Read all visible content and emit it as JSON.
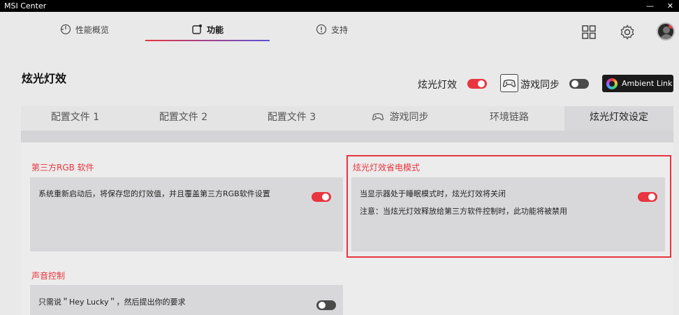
{
  "app": {
    "title": "MSI Center",
    "minimize": "—",
    "close": "✕"
  },
  "nav": {
    "tabs": [
      {
        "label": "性能概览",
        "icon": "gauge-icon"
      },
      {
        "label": "功能",
        "icon": "feature-icon"
      },
      {
        "label": "支持",
        "icon": "support-icon"
      }
    ],
    "active": 1
  },
  "header": {
    "title": "炫光灯效",
    "mystic_label": "炫光灯效",
    "mystic_on": true,
    "gamesync_label": "游戏同步",
    "gamesync_on": false,
    "ambient_label": "Ambient Link"
  },
  "subtabs": [
    "配置文件 1",
    "配置文件 2",
    "配置文件 3",
    "游戏同步",
    "环境链路",
    "炫光灯效设定"
  ],
  "sections": {
    "rgb": {
      "title": "第三方RGB 软件",
      "text": "系统重新启动后，将保存您的灯效值，并且覆盖第三方RGB软件设置",
      "on": true
    },
    "power": {
      "title": "炫光灯效省电模式",
      "text1": "当显示器处于睡眠模式时，炫光灯效将关闭",
      "text2": "注意：当炫光灯效释放给第三方软件控制时，此功能将被禁用",
      "on": true
    },
    "voice": {
      "title": "声音控制",
      "text": "只需说＂Hey Lucky＂，然后提出你的要求",
      "on": false
    }
  },
  "colors": {
    "accent": "#e8353f",
    "dark": "#1b1b1b"
  }
}
